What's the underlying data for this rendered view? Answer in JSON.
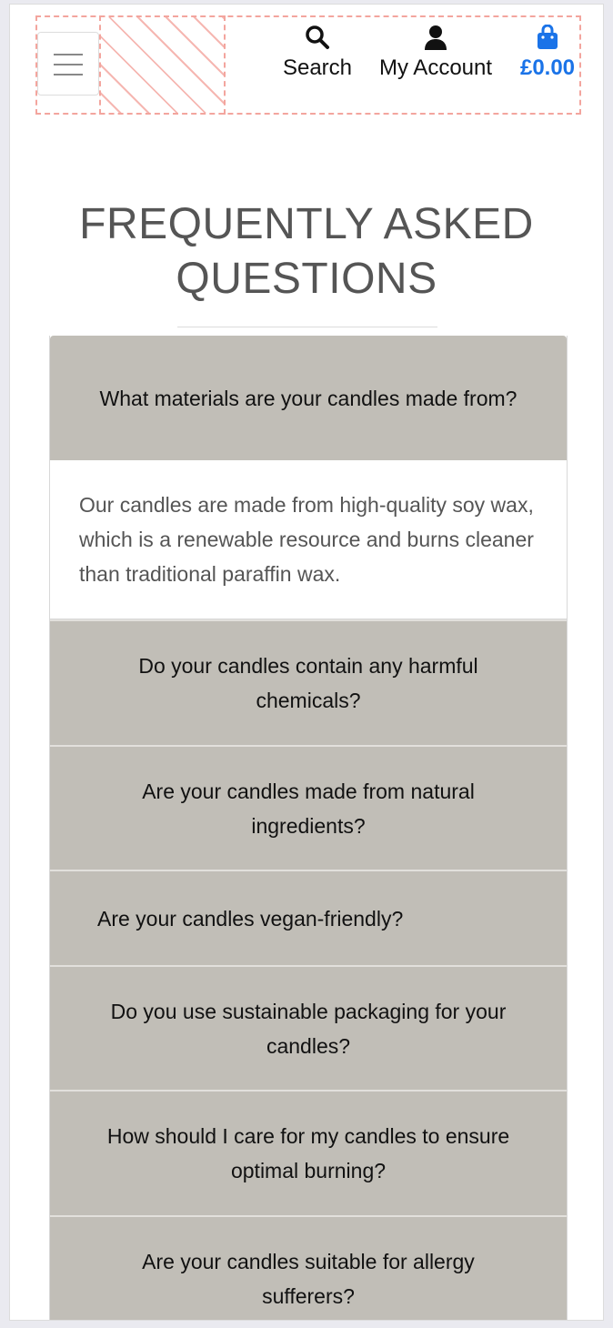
{
  "header": {
    "nav": {
      "search_label": "Search",
      "account_label": "My Account",
      "cart_total": "£0.00"
    },
    "icons": {
      "menu": "hamburger-icon",
      "search": "search-icon",
      "account": "user-icon",
      "cart": "shopping-bag-icon"
    },
    "accent_color": "#1a73e8"
  },
  "main": {
    "title_line1": "FREQUENTLY ASKED",
    "title_line2": "QUESTIONS",
    "faq": [
      {
        "question": "What materials are your candles made from?",
        "answer": "Our candles are made from high-quality soy wax, which is a renewable resource and burns cleaner than traditional paraffin wax."
      },
      {
        "question": "Do your candles contain any harmful chemicals?"
      },
      {
        "question": "Are your candles made from natural ingredients?"
      },
      {
        "question": "Are your candles vegan-friendly?"
      },
      {
        "question": "Do you use sustainable packaging for your candles?"
      },
      {
        "question": "How should I care for my candles to ensure optimal burning?"
      },
      {
        "question": "Are your candles suitable for allergy sufferers?"
      }
    ]
  }
}
